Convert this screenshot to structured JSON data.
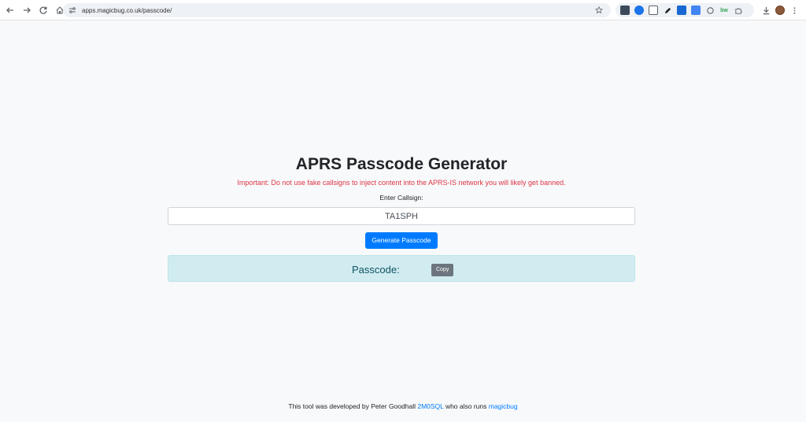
{
  "browser": {
    "url": "apps.magicbug.co.uk/passcode/",
    "extensions": [
      {
        "name": "extension-1",
        "color": "#3c4a5c"
      },
      {
        "name": "extension-2",
        "color": "#1a73e8"
      },
      {
        "name": "extension-3",
        "color": "#5f6368"
      },
      {
        "name": "extension-4",
        "color": "#202124"
      },
      {
        "name": "extension-5",
        "color": "#1967d2"
      },
      {
        "name": "extension-6",
        "color": "#4285f4"
      },
      {
        "name": "extension-7",
        "color": "#5f6368"
      },
      {
        "name": "extension-8",
        "color": "#34a853"
      },
      {
        "name": "extension-9",
        "color": "#5f6368"
      }
    ]
  },
  "page": {
    "title": "APRS Passcode Generator",
    "warning": "Important: Do not use fake callsigns to inject content into the APRS-IS network you will likely get banned.",
    "callsign_label": "Enter Callsign:",
    "callsign_value": "TA1SPH",
    "generate_button": "Generate Passcode",
    "passcode_label": "Passcode:",
    "copy_button": "Copy"
  },
  "footer": {
    "prefix": "This tool was developed by Peter Goodhall ",
    "callsign_link": "2M0SQL",
    "middle": " who also runs ",
    "site_link": "magicbug"
  },
  "colors": {
    "primary": "#007bff",
    "danger": "#dc3545",
    "info_bg": "#d1ecf1",
    "info_text": "#0c5460",
    "secondary": "#6c757d"
  }
}
